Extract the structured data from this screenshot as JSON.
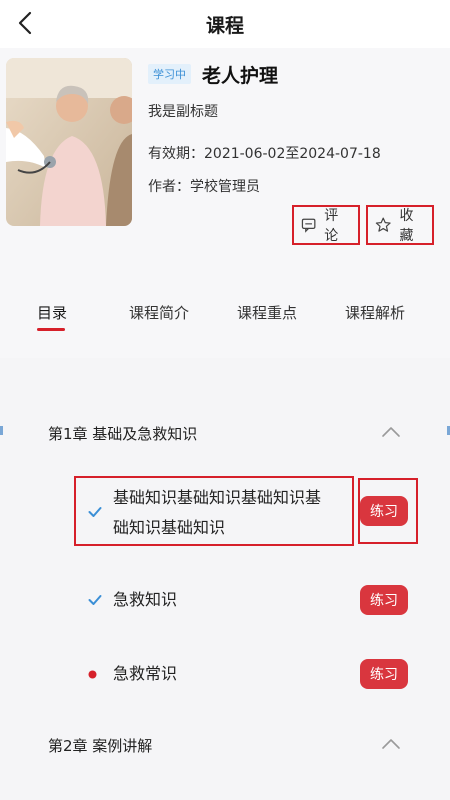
{
  "header": {
    "title": "课程",
    "back_icon": "chevron-left-icon"
  },
  "course": {
    "badge": "学习中",
    "title": "老人护理",
    "subtitle": "我是副标题",
    "validity": "有效期：2021-06-02至2024-07-18",
    "author": "作者：学校管理员",
    "cover_icon": "course-cover-image"
  },
  "actions": {
    "comment_label": "评论",
    "comment_icon": "comment-icon",
    "favorite_label": "收藏",
    "favorite_icon": "star-icon"
  },
  "tabs": [
    {
      "label": "目录",
      "active": true
    },
    {
      "label": "课程简介",
      "active": false
    },
    {
      "label": "课程重点",
      "active": false
    },
    {
      "label": "课程解析",
      "active": false
    }
  ],
  "chapters": [
    {
      "title": "第1章 基础及急救知识",
      "expanded": true,
      "lessons": [
        {
          "title_line1": "基础知识基础知识基础知识基",
          "title_line2": "础知识基础知识",
          "status": "completed",
          "action": "练习"
        },
        {
          "title": "急救知识",
          "status": "completed",
          "action": "练习"
        },
        {
          "title": "急救常识",
          "status": "in-progress",
          "action": "练习"
        }
      ]
    },
    {
      "title": "第2章 案例讲解",
      "expanded": true
    }
  ],
  "colors": {
    "accent": "#d9363e",
    "check": "#3b8fd6",
    "badge_bg": "#e3f0fb"
  }
}
